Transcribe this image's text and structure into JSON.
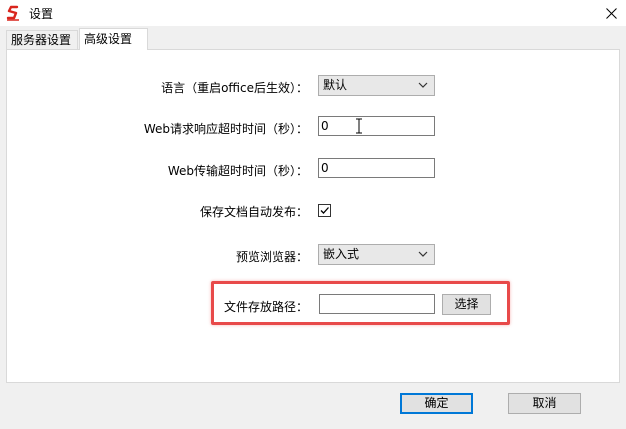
{
  "window": {
    "title": "设置",
    "close_glyph": "✕"
  },
  "tabs": [
    {
      "label": "服务器设置",
      "active": false
    },
    {
      "label": "高级设置",
      "active": true
    }
  ],
  "settings": {
    "language": {
      "label": "语言（重启office后生效）：",
      "value": "默认"
    },
    "web_request_timeout": {
      "label": "Web请求响应超时时间（秒）：",
      "value": "0"
    },
    "web_transfer_timeout": {
      "label": "Web传输超时时间（秒）：",
      "value": "0"
    },
    "auto_publish": {
      "label": "保存文档自动发布：",
      "checked": true
    },
    "preview_browser": {
      "label": "预览浏览器：",
      "value": "嵌入式"
    },
    "file_path": {
      "label": "文件存放路径：",
      "value": "",
      "browse_label": "选择"
    }
  },
  "footer": {
    "ok_label": "确定",
    "cancel_label": "取消"
  },
  "colors": {
    "highlight": "#e84a4a",
    "default_button_border": "#0078d7",
    "app_icon": "#d9251d"
  }
}
